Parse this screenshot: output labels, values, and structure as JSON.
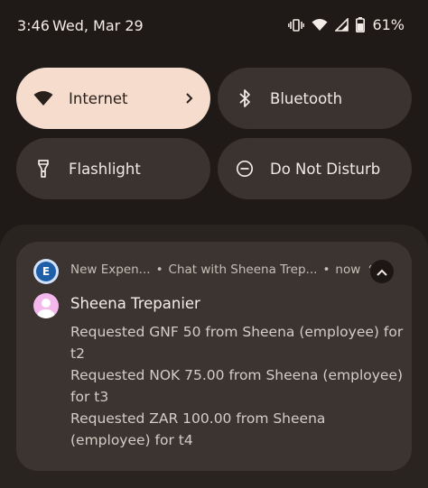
{
  "statusbar": {
    "time": "3:46",
    "date": "Wed, Mar 29",
    "battery_percent": "61%",
    "icons": [
      "vibrate-icon",
      "wifi-icon",
      "signal-icon",
      "battery-icon"
    ]
  },
  "quick_settings": {
    "tiles": [
      {
        "label": "Internet",
        "icon": "wifi-icon",
        "active": true,
        "has_chevron": true
      },
      {
        "label": "Bluetooth",
        "icon": "bluetooth-icon",
        "active": false
      },
      {
        "label": "Flashlight",
        "icon": "flashlight-icon",
        "active": false
      },
      {
        "label": "Do Not Disturb",
        "icon": "do-not-disturb-icon",
        "active": false
      }
    ]
  },
  "notification": {
    "app_icon_letter": "E",
    "app_name": "New Expen...",
    "conversation": "Chat with Sheena Trep...",
    "time": "now",
    "sender": "Sheena Trepanier",
    "messages": [
      "Requested GNF 50 from Sheena (employee) for t2",
      "Requested NOK 75.00 from Sheena (employee) for t3",
      "Requested ZAR 100.00 from Sheena (employee) for t4"
    ]
  },
  "colors": {
    "background": "#1f1a17",
    "tile_active": "#f6dccd",
    "tile_inactive": "#3a3330",
    "card": "#3b3431",
    "avatar": "#f4b8ec"
  }
}
